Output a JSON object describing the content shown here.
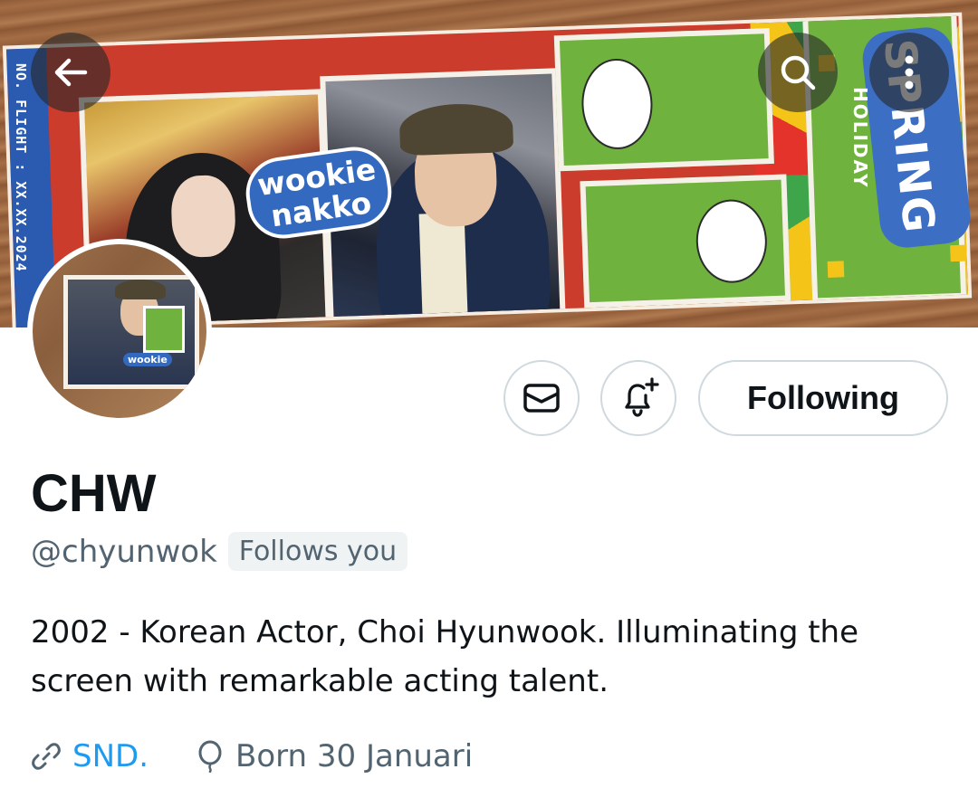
{
  "banner": {
    "flight_text": "NO. FLIGHT : XX.XX.2024",
    "sticker_label_line1": "wookie",
    "sticker_label_line2": "nakko",
    "spring_word": "SPRING",
    "holiday_word": "HOLIDAY",
    "avatar_label": "wookie"
  },
  "top_nav": {
    "back_icon": "arrow-left-icon",
    "search_icon": "search-icon",
    "more_icon": "more-vertical-icon"
  },
  "actions": {
    "message_icon": "envelope-icon",
    "notify_icon": "bell-plus-icon",
    "following_label": "Following"
  },
  "profile": {
    "display_name": "CHW",
    "handle": "@chyunwok",
    "follows_you_badge": "Follows you",
    "bio": "2002 - Korean Actor, Choi Hyunwook. Illuminating the screen with remarkable acting talent.",
    "link_text": "SND.",
    "birthday_text": "Born 30 Januari"
  },
  "colors": {
    "link": "#1d9bf0",
    "secondary_text": "#536471",
    "primary_text": "#0f1419",
    "button_border": "#cfd9de"
  }
}
